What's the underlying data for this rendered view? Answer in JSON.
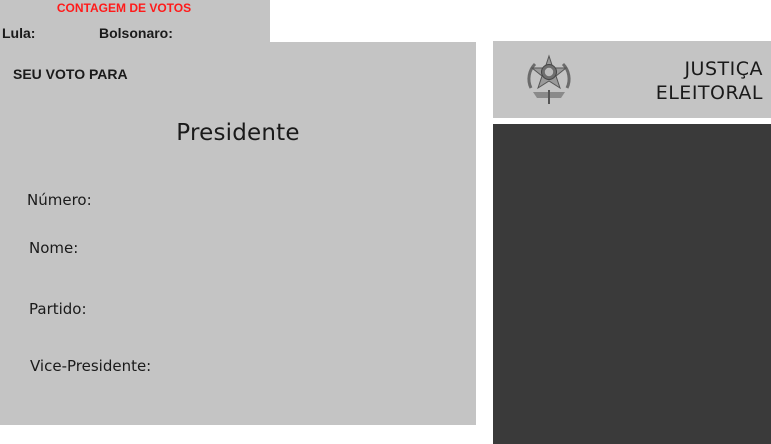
{
  "vote_count": {
    "title": "CONTAGEM DE VOTOS",
    "candidate_a_label": "Lula:",
    "candidate_b_label": "Bolsonaro:",
    "title_color": "#ff1a1a"
  },
  "ballot": {
    "vote_for_label": "SEU VOTO PARA",
    "office": "Presidente",
    "fields": {
      "numero": "Número:",
      "nome": "Nome:",
      "partido": "Partido:",
      "vice": "Vice-Presidente:"
    }
  },
  "brand": {
    "emblem_icon": "coat-of-arms-icon",
    "line1": "JUSTIÇA",
    "line2": "ELEITORAL"
  },
  "colors": {
    "panel_gray": "#c4c4c4",
    "keypad_dark": "#3a3a3a"
  }
}
